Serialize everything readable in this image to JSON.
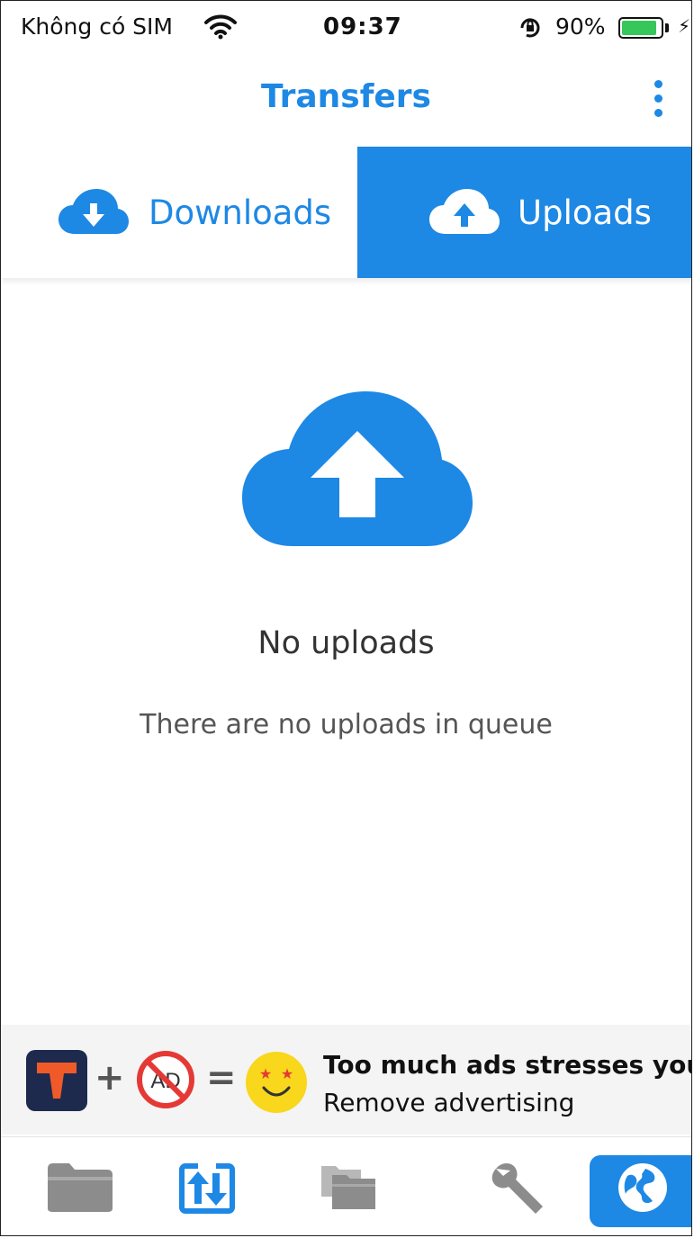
{
  "status_bar": {
    "carrier": "Không có SIM",
    "time": "09:37",
    "battery_percent": "90%",
    "battery_level": 0.9
  },
  "header": {
    "title": "Transfers"
  },
  "tabs": {
    "downloads_label": "Downloads",
    "uploads_label": "Uploads",
    "active": "Uploads"
  },
  "empty_state": {
    "title": "No uploads",
    "subtitle": "There are no uploads in queue"
  },
  "ad_banner": {
    "no_ad_text": "AD",
    "line1": "Too much ads stresses you?",
    "line2": "Remove advertising"
  },
  "bottom_tabs": [
    {
      "name": "files",
      "icon": "folder-icon"
    },
    {
      "name": "transfers",
      "icon": "transfers-icon",
      "active": true
    },
    {
      "name": "offline",
      "icon": "offline-folders-icon"
    },
    {
      "name": "tools",
      "icon": "wrench-icon"
    },
    {
      "name": "browser",
      "icon": "globe-icon"
    }
  ],
  "colors": {
    "accent": "#1e88e5",
    "battery": "#35c759"
  }
}
